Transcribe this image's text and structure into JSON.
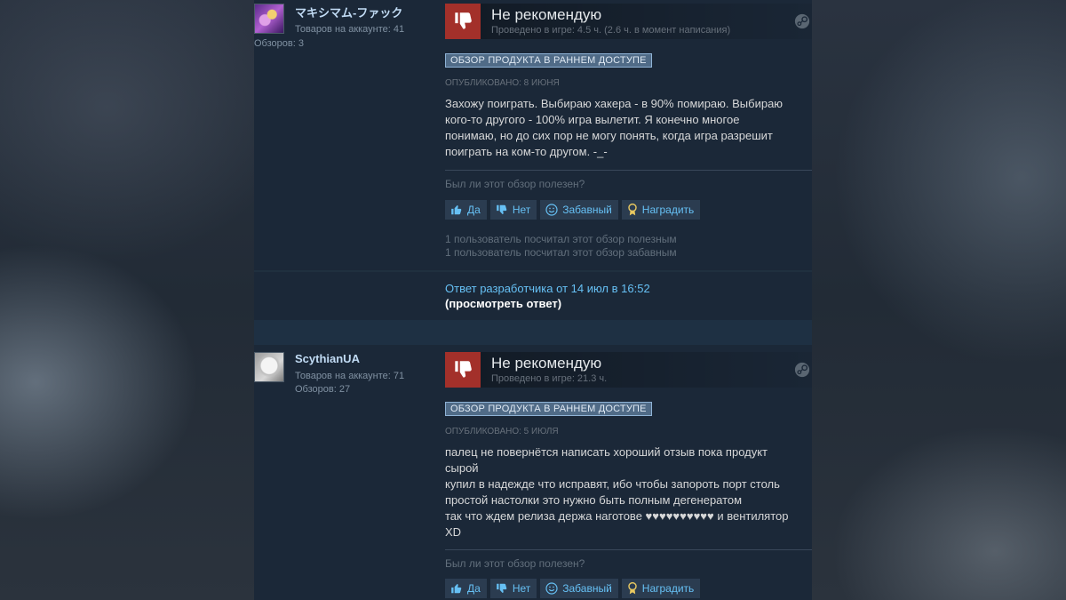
{
  "reviews": [
    {
      "author": {
        "persona_name": "マキシマム-ファック",
        "owned_games": "Товаров на аккаунте: 41",
        "review_count": "Обзоров: 3"
      },
      "vote_title": "Не рекомендую",
      "hours": "Проведено в игре: 4.5 ч. (2.6 ч. в момент написания)",
      "early_access_badge": "ОБЗОР ПРОДУКТА В РАННЕМ ДОСТУПЕ",
      "posted": "ОПУБЛИКОВАНО: 8 ИЮНЯ",
      "content": [
        "Захожу поиграть. Выбираю хакера - в 90% помираю. Выбираю",
        "кого-то другого - 100% игра вылетит. Я конечно многое",
        "понимаю, но до сих пор не могу понять, когда игра разрешит",
        "поиграть на ком-то другом. -_-"
      ],
      "helpful_question": "Был ли этот обзор полезен?",
      "buttons": {
        "yes": "Да",
        "no": "Нет",
        "funny": "Забавный",
        "award": "Наградить"
      },
      "stats": [
        "1 пользователь посчитал этот обзор полезным",
        "1 пользователь посчитал этот обзор забавным"
      ],
      "developer_response": {
        "link": "Ответ разработчика от 14 июл в 16:52",
        "view": "(просмотреть ответ)"
      }
    },
    {
      "author": {
        "persona_name": "ScythianUA",
        "owned_games": "Товаров на аккаунте: 71",
        "review_count": "Обзоров: 27"
      },
      "vote_title": "Не рекомендую",
      "hours": "Проведено в игре: 21.3 ч.",
      "early_access_badge": "ОБЗОР ПРОДУКТА В РАННЕМ ДОСТУПЕ",
      "posted": "ОПУБЛИКОВАНО: 5 ИЮЛЯ",
      "content": [
        "палец не повернётся написать хороший отзыв пока продукт",
        "сырой",
        "купил в надежде что исправят, ибо чтобы запороть порт столь",
        "простой настолки это нужно быть полным дегенератом",
        "так что ждем релиза держа наготове ♥♥♥♥♥♥♥♥♥♥ и вентилятор",
        "XD"
      ],
      "helpful_question": "Был ли этот обзор полезен?",
      "buttons": {
        "yes": "Да",
        "no": "Нет",
        "funny": "Забавный",
        "award": "Наградить"
      }
    }
  ]
}
